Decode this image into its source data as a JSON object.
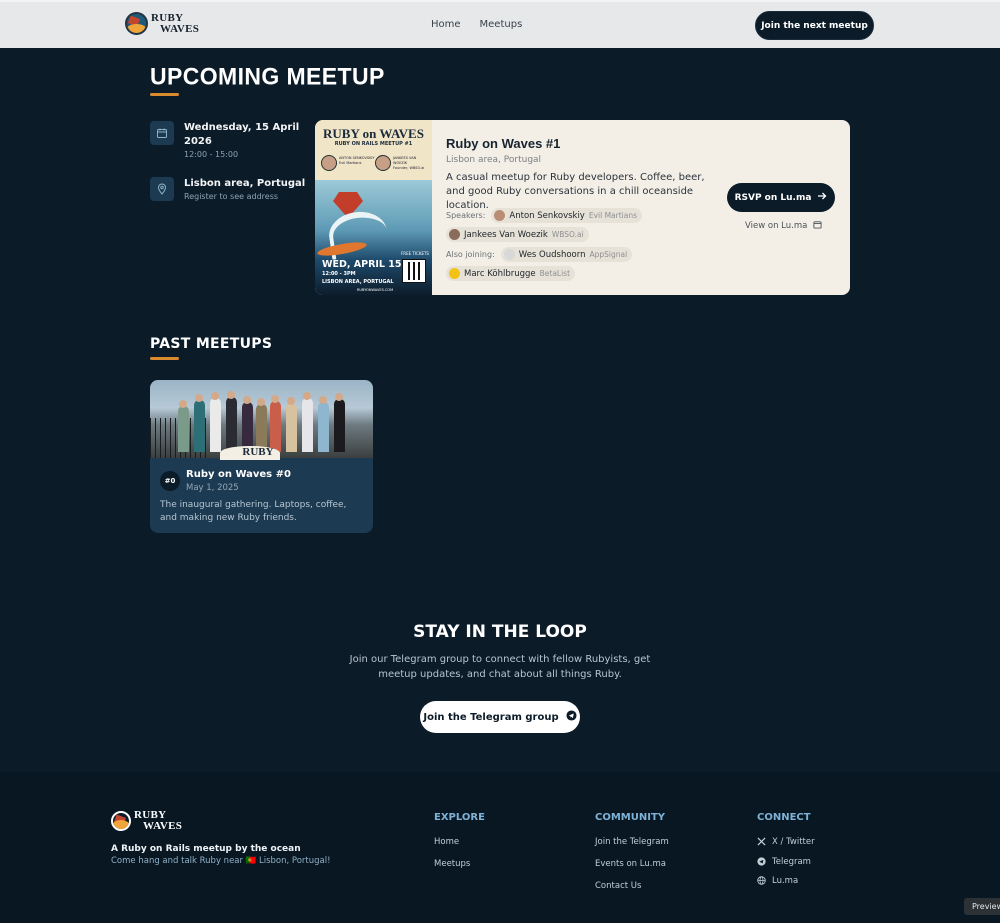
{
  "header": {
    "logo_line1": "RUBY",
    "logo_line2": "WAVES",
    "nav": [
      "Home",
      "Meetups"
    ],
    "cta": "Join the next meetup"
  },
  "upcoming": {
    "heading": "UPCOMING MEETUP",
    "date_line1": "Wednesday, 15 April",
    "date_line2": "2026",
    "time": "12:00 - 15:00",
    "location": "Lisbon area, Portugal",
    "location_note": "Register to see address",
    "poster": {
      "title": "RUBY on WAVES",
      "subtitle": "RUBY ON RAILS MEETUP #1",
      "speaker1": "ANTON SENKOVSKIY",
      "speaker1_co": "Evil Martians",
      "speaker2": "JANKEES VAN WOEZIK",
      "speaker2_co": "Founder, WBSO.ai",
      "date": "WED, APRIL 15",
      "time": "12:00 - 3PM",
      "place": "LISBON AREA, PORTUGAL",
      "url": "RUBYONWAVES.COM",
      "free": "FREE TICKETS"
    },
    "card": {
      "title": "Ruby on Waves #1",
      "location": "Lisbon area, Portugal",
      "description": "A casual meetup for Ruby developers. Coffee, beer, and good Ruby conversations in a chill oceanside location.",
      "speakers_label": "Speakers:",
      "speakers": [
        {
          "name": "Anton Senkovskiy",
          "company": "Evil Martians"
        },
        {
          "name": "Jankees Van Woezik",
          "company": "WBSO.ai"
        }
      ],
      "also_label": "Also joining:",
      "also": [
        {
          "name": "Wes Oudshoorn",
          "company": "AppSignal"
        },
        {
          "name": "Marc Köhlbrugge",
          "company": "BetaList"
        }
      ],
      "rsvp": "RSVP on Lu.ma",
      "view": "View on Lu.ma"
    }
  },
  "past": {
    "heading": "PAST MEETUPS",
    "items": [
      {
        "number": "#0",
        "title": "Ruby on Waves #0",
        "date": "May 1, 2025",
        "description": "The inaugural gathering. Laptops, coffee, and making new Ruby friends.",
        "photo_badge": "RUBY"
      }
    ]
  },
  "loop": {
    "heading": "STAY IN THE LOOP",
    "text": "Join our Telegram group to connect with fellow Rubyists, get meetup updates, and chat about all things Ruby.",
    "button": "Join the Telegram group"
  },
  "footer": {
    "logo_line1": "RUBY",
    "logo_line2": "WAVES",
    "tagline": "A Ruby on Rails meetup by the ocean",
    "subline": "Come hang and talk Ruby near 🇵🇹 Lisbon, Portugal!",
    "explore": {
      "heading": "EXPLORE",
      "links": [
        "Home",
        "Meetups"
      ]
    },
    "community": {
      "heading": "COMMUNITY",
      "links": [
        "Join the Telegram",
        "Events on Lu.ma",
        "Contact Us"
      ]
    },
    "connect": {
      "heading": "CONNECT",
      "links": [
        "X / Twitter",
        "Telegram",
        "Lu.ma"
      ]
    }
  },
  "preview_label": "Preview",
  "colors": {
    "bg": "#0b1b28",
    "accent": "#d88a2c",
    "card": "#f3efe6",
    "past_card": "#1c3a52"
  }
}
